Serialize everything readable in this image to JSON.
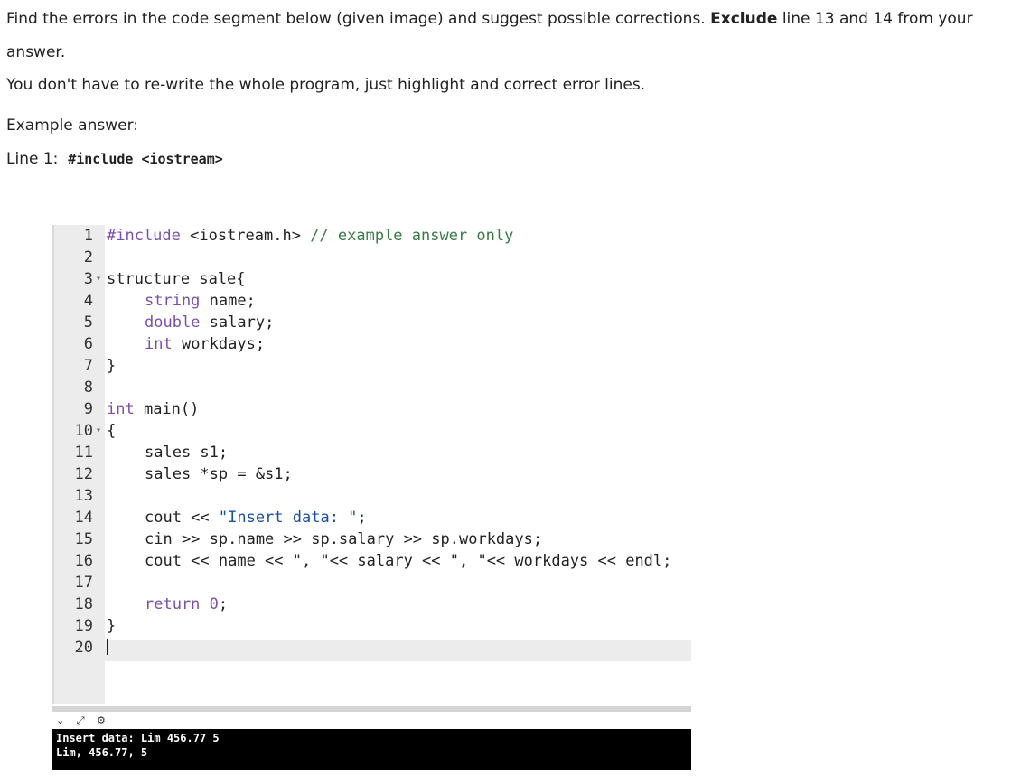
{
  "question": {
    "line1_prefix": "Find the errors in the code segment below (given image) and suggest possible corrections.",
    "line1_bold": "Exclude",
    "line1_suffix": "line 13 and 14 from your",
    "line2": "answer.",
    "line3": "You don't have to re-write the whole program, just highlight and correct error lines.",
    "example_label": "Example answer:",
    "example_line_label": "Line 1:",
    "example_code": "#include <iostream>"
  },
  "editor": {
    "line_numbers": [
      "1",
      "2",
      "3",
      "4",
      "5",
      "6",
      "7",
      "8",
      "9",
      "10",
      "11",
      "12",
      "13",
      "14",
      "15",
      "16",
      "17",
      "18",
      "19",
      "20"
    ],
    "lines": {
      "l1_kw": "#include",
      "l1_rest": " <iostream.h> ",
      "l1_comment": "// example answer only",
      "l3": "structure sale{",
      "l4_type": "string",
      "l4_rest": " name;",
      "l5_type": "double",
      "l5_rest": " salary;",
      "l6_type": "int",
      "l6_rest": " workdays;",
      "l7": "}",
      "l9_type": "int",
      "l9_rest": " main()",
      "l10": "{",
      "l11": "sales s1;",
      "l12": "sales *sp = &s1;",
      "l14_a": "cout << ",
      "l14_str": "\"Insert data: \"",
      "l14_b": ";",
      "l15": "cin >> sp.name >> sp.salary >> sp.workdays;",
      "l16": "cout << name << \", \"<< salary << \", \"<< workdays << endl;",
      "l18_kw": "return",
      "l18_sp": " ",
      "l18_num": "0",
      "l18_end": ";",
      "l19": "}"
    }
  },
  "console": {
    "line1": "Insert data: Lim 456.77 5",
    "line2": "Lim, 456.77, 5"
  },
  "toolbar": {
    "collapse_glyph": "⌄",
    "expand_glyph": "⤢",
    "settings_glyph": "⚙"
  }
}
